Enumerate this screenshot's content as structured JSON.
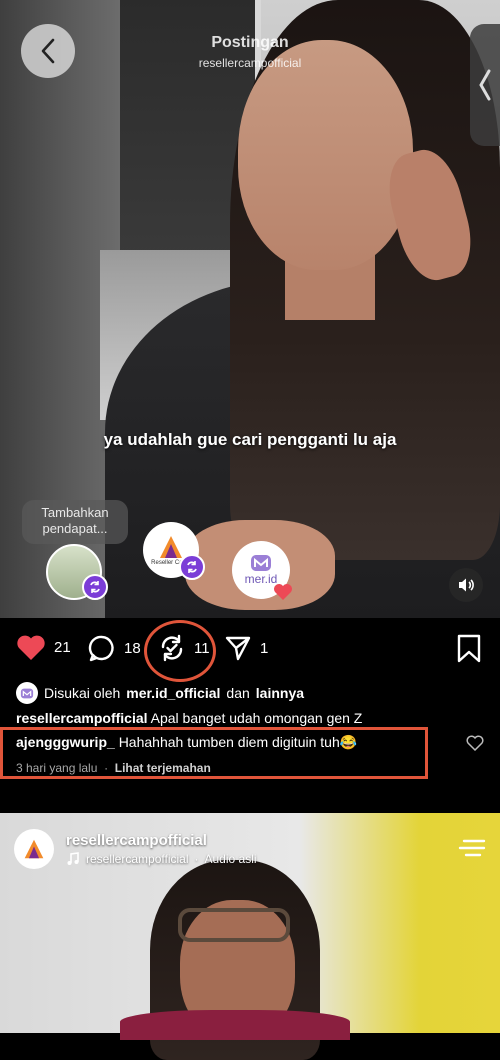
{
  "header": {
    "title": "Postingan",
    "subtitle": "resellercampofficial"
  },
  "video": {
    "caption": "ya udahlah gue cari pengganti lu aja",
    "opinion_prompt": "Tambahkan pendapat...",
    "avatar2_label": "Reseller Camp",
    "avatar3_label": "mer.id"
  },
  "actions": {
    "likes": "21",
    "comments": "18",
    "reposts": "11",
    "shares": "1"
  },
  "likes_line": {
    "prefix": "Disukai oleh",
    "user": "mer.id_official",
    "connector": "dan",
    "others": "lainnya"
  },
  "post_caption": {
    "user": "resellercampofficial",
    "text": "Apal banget udah omongan gen Z"
  },
  "comment": {
    "user": "ajengggwurip_",
    "text": "Hahahhah tumben diem digituin tuh😂",
    "time": "3 hari yang lalu",
    "translate": "Lihat terjemahan"
  },
  "next_post": {
    "user": "resellercampofficial",
    "audio_user": "resellercampofficial",
    "audio_label": "Audio asli"
  },
  "colors": {
    "heart": "#ed4956",
    "highlight": "#e0553a",
    "repost_badge": "#7b3dd7"
  }
}
